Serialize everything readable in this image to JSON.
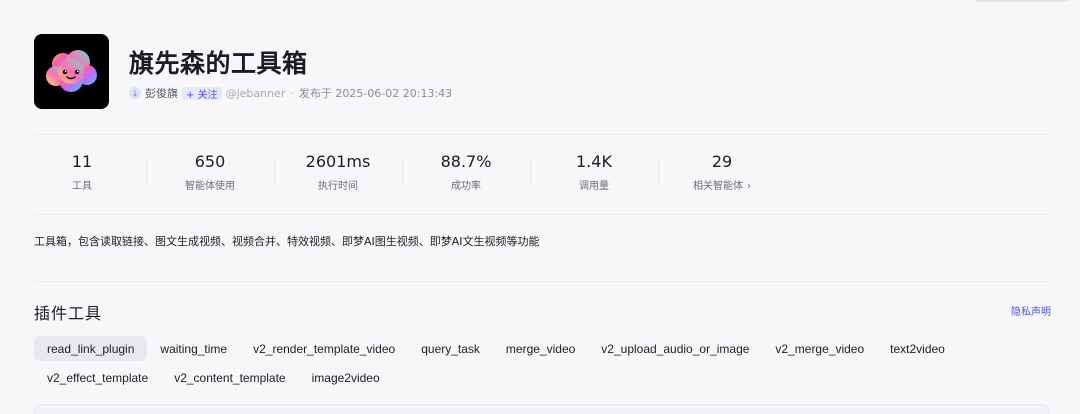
{
  "plugin": {
    "title": "旗先森的工具箱",
    "author": "彭俊旗",
    "follow_label": "+ 关注",
    "handle": "@jebanner",
    "dot": "·",
    "published": "发布于 2025-06-02 20:13:43",
    "avatar_icon": "rainbow-cloud-icon"
  },
  "stats": [
    {
      "value": "11",
      "label": "工具"
    },
    {
      "value": "650",
      "label": "智能体使用"
    },
    {
      "value": "2601ms",
      "label": "执行时间"
    },
    {
      "value": "88.7%",
      "label": "成功率"
    },
    {
      "value": "1.4K",
      "label": "调用量"
    },
    {
      "value": "29",
      "label": "相关智能体",
      "chevron": "›"
    }
  ],
  "description": "工具箱，包含读取链接、图文生成视频、视频合并、特效视频、即梦AI图生视频、即梦AI文生视频等功能",
  "section": {
    "title": "插件工具",
    "privacy_label": "隐私声明"
  },
  "tools": [
    "read_link_plugin",
    "waiting_time",
    "v2_render_template_video",
    "query_task",
    "merge_video",
    "v2_upload_audio_or_image",
    "v2_merge_video",
    "text2video",
    "v2_effect_template",
    "v2_content_template",
    "image2video"
  ],
  "active_tool": "read_link_plugin",
  "colors": {
    "accent": "#4d53e8",
    "background": "#f7f7fa",
    "text": "#1c1d23"
  }
}
